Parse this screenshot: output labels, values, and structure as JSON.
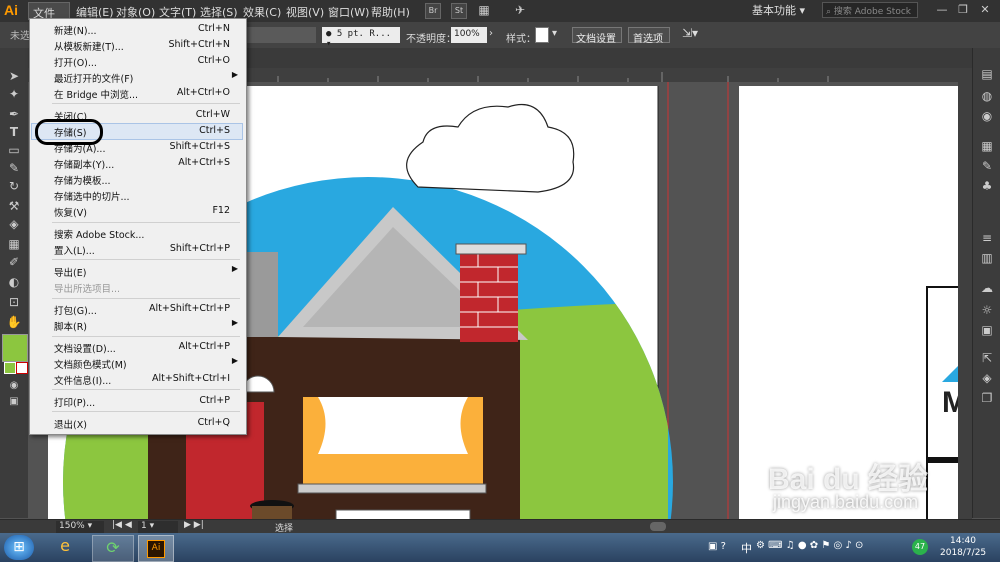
{
  "app": {
    "logo": "Ai",
    "workspace": "基本功能",
    "search_placeholder": "搜索 Adobe Stock"
  },
  "menubar": {
    "items": [
      "文件(F)",
      "编辑(E)",
      "对象(O)",
      "文字(T)",
      "选择(S)",
      "效果(C)",
      "视图(V)",
      "窗口(W)",
      "帮助(H)"
    ],
    "icons": {
      "br": "Br",
      "st": "St"
    }
  },
  "controlbar": {
    "left_label": "未选",
    "stroke_value": "5 pt. R...",
    "opacity_label": "不透明度：",
    "opacity_value": "100%",
    "style_label": "样式：",
    "doc_setup": "文档设置",
    "prefs": "首选项"
  },
  "file_menu": {
    "items": [
      {
        "label": "新建(N)...",
        "shortcut": "Ctrl+N"
      },
      {
        "label": "从模板新建(T)...",
        "shortcut": "Shift+Ctrl+N"
      },
      {
        "label": "打开(O)...",
        "shortcut": "Ctrl+O"
      },
      {
        "label": "最近打开的文件(F)",
        "shortcut": "",
        "submenu": true
      },
      {
        "label": "在 Bridge 中浏览...",
        "shortcut": "Alt+Ctrl+O"
      },
      {
        "label": "关闭(C)",
        "shortcut": "Ctrl+W"
      },
      {
        "label": "存储(S)",
        "shortcut": "Ctrl+S"
      },
      {
        "label": "存储为(A)...",
        "shortcut": "Shift+Ctrl+S"
      },
      {
        "label": "存储副本(Y)...",
        "shortcut": "Alt+Ctrl+S"
      },
      {
        "label": "存储为模板...",
        "shortcut": ""
      },
      {
        "label": "存储选中的切片...",
        "shortcut": ""
      },
      {
        "label": "恢复(V)",
        "shortcut": "F12"
      },
      {
        "label": "搜索 Adobe Stock...",
        "shortcut": ""
      },
      {
        "label": "置入(L)...",
        "shortcut": "Shift+Ctrl+P"
      },
      {
        "label": "导出(E)",
        "shortcut": "",
        "submenu": true
      },
      {
        "label": "导出所选项目...",
        "shortcut": "",
        "disabled": true
      },
      {
        "label": "打包(G)...",
        "shortcut": "Alt+Shift+Ctrl+P"
      },
      {
        "label": "脚本(R)",
        "shortcut": "",
        "submenu": true
      },
      {
        "label": "文档设置(D)...",
        "shortcut": "Alt+Ctrl+P"
      },
      {
        "label": "文档颜色模式(M)",
        "shortcut": "",
        "submenu": true
      },
      {
        "label": "文件信息(I)...",
        "shortcut": "Alt+Shift+Ctrl+I"
      },
      {
        "label": "打印(P)...",
        "shortcut": "Ctrl+P"
      },
      {
        "label": "退出(X)",
        "shortcut": "Ctrl+Q"
      }
    ]
  },
  "statusbar": {
    "zoom": "150%",
    "page": "1",
    "tool": "选择"
  },
  "taskbar": {
    "time": "14:40",
    "date": "2018/7/25",
    "ime": "中",
    "badge": "47",
    "app_label": "Ai"
  },
  "watermark": {
    "logo_text": "Bai du 经验",
    "url": "jingyan.baidu.com"
  },
  "colors": {
    "accent": "#ff9a00",
    "sky": "#29a8e0",
    "grass": "#8cc63f",
    "house": "#3f2418",
    "door": "#c1272d",
    "curtain": "#fbb03b",
    "brick": "#c1272d"
  }
}
